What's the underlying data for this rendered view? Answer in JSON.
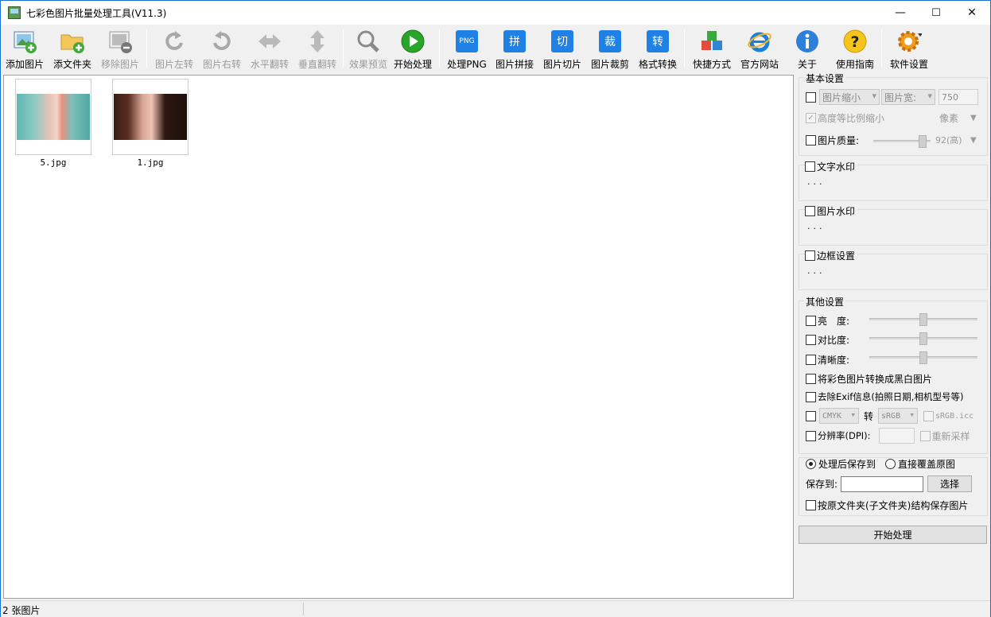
{
  "window": {
    "title": "七彩色图片批量处理工具(V11.3)",
    "minimize": "—",
    "maximize": "☐",
    "close": "✕"
  },
  "toolbar": {
    "add_image": "添加图片",
    "add_folder": "添文件夹",
    "remove_image": "移除图片",
    "rotate_left": "图片左转",
    "rotate_right": "图片右转",
    "flip_h": "水平翻转",
    "flip_v": "垂直翻转",
    "preview": "效果预览",
    "start": "开始处理",
    "png": "处理PNG",
    "png_icon": "PNG",
    "stitch": "图片拼接",
    "stitch_icon": "拼",
    "slice": "图片切片",
    "slice_icon": "切",
    "crop": "图片裁剪",
    "crop_icon": "裁",
    "convert": "格式转换",
    "convert_icon": "转",
    "shortcut": "快捷方式",
    "website": "官方网站",
    "about": "关于",
    "guide": "使用指南",
    "settings": "软件设置"
  },
  "files": [
    {
      "name": "5.jpg"
    },
    {
      "name": "1.jpg"
    }
  ],
  "basic": {
    "title": "基本设置",
    "resize_mode": "图片缩小",
    "dimension": "图片宽:",
    "width_value": "750",
    "keep_ratio": "高度等比例缩小",
    "unit": "像素",
    "quality_label": "图片质量:",
    "quality_value": "92(高)",
    "quality_level": 0.92
  },
  "text_watermark": {
    "title": "文字水印",
    "dots": "..."
  },
  "image_watermark": {
    "title": "图片水印",
    "dots": "..."
  },
  "border": {
    "title": "边框设置",
    "dots": "..."
  },
  "other": {
    "title": "其他设置",
    "brightness": "亮　度:",
    "contrast": "对比度:",
    "sharpness": "清晰度:",
    "grayscale": "将彩色图片转换成黑白图片",
    "remove_exif": "去除Exif信息(拍照日期,相机型号等)",
    "color_from": "CMYK",
    "to": "转",
    "color_to": "sRGB",
    "icc": "sRGB.icc",
    "dpi": "分辨率(DPI):",
    "resample": "重新采样"
  },
  "save": {
    "save_after": "处理后保存到",
    "overwrite": "直接覆盖原图",
    "save_to": "保存到:",
    "choose": "选择",
    "keep_structure": "按原文件夹(子文件夹)结构保存图片"
  },
  "start_button": "开始处理",
  "status": {
    "count": "2 张图片"
  }
}
